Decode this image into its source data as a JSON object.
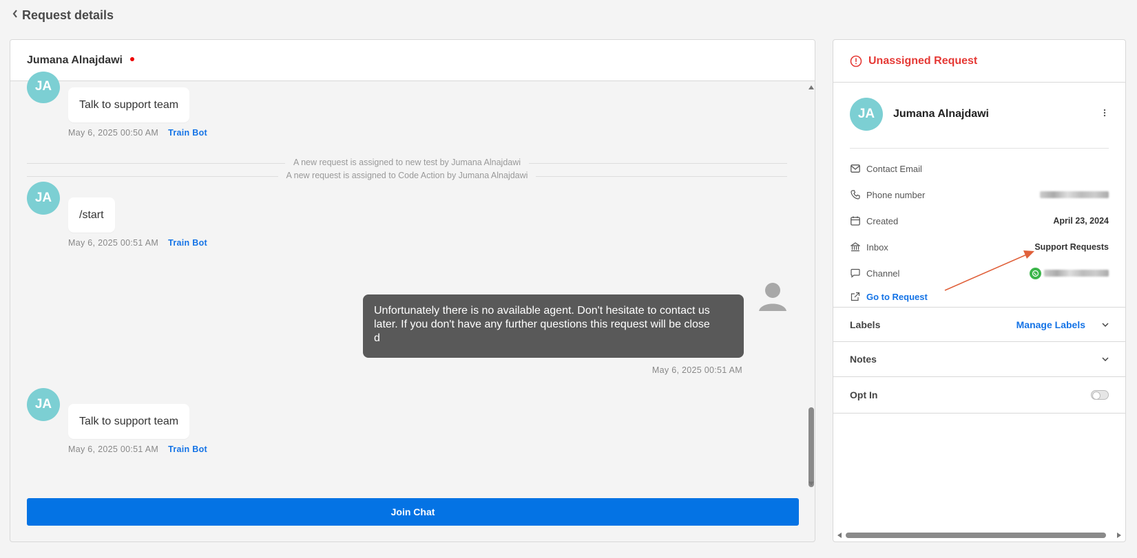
{
  "header": {
    "back_icon": "chevron-left-icon",
    "title": "Request details"
  },
  "chat": {
    "contact_name": "Jumana Alnajdawi",
    "status_dot_color": "#e00000",
    "avatar_initials": "JA",
    "messages": [
      {
        "text": "Talk to support team",
        "time": "May 6, 2025 00:50 AM",
        "train_label": "Train Bot"
      },
      {
        "text": "/start",
        "time": "May 6, 2025 00:51 AM",
        "train_label": "Train Bot"
      },
      {
        "text": "Talk to support team",
        "time": "May 6, 2025 00:51 AM",
        "train_label": "Train Bot"
      }
    ],
    "system_notes": [
      "A new request is assigned to new test by Jumana Alnajdawi",
      "A new request is assigned to Code Action by Jumana Alnajdawi"
    ],
    "agent_message": {
      "line1": "Unfortunately there is no available agent. Don't hesitate to contact us",
      "line2": "later. If you don't have any further questions this request will be close",
      "line3": "d",
      "time": "May 6, 2025 00:51 AM"
    },
    "join_button": "Join Chat",
    "accent_color": "#0473e4"
  },
  "sidebar": {
    "status": {
      "icon": "alert-circle-icon",
      "label": "Unassigned Request",
      "color": "#e53935"
    },
    "contact": {
      "initials": "JA",
      "name": "Jumana Alnajdawi",
      "menu_icon": "kebab-icon"
    },
    "info": {
      "email_label": "Contact Email",
      "phone_label": "Phone number",
      "created_label": "Created",
      "created_value": "April 23, 2024",
      "inbox_label": "Inbox",
      "inbox_value": "Support Requests",
      "channel_label": "Channel",
      "goto_label": "Go to Request"
    },
    "sections": {
      "labels": "Labels",
      "manage_labels": "Manage Labels",
      "notes": "Notes",
      "opt_in": "Opt In"
    }
  }
}
